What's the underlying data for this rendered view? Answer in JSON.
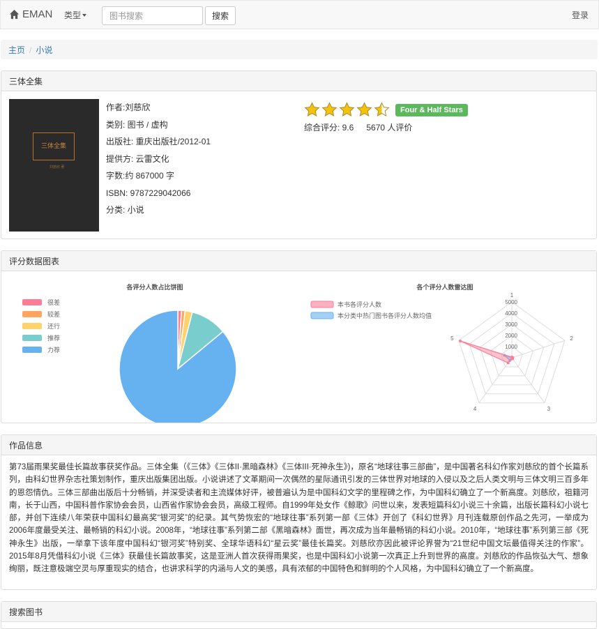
{
  "nav": {
    "brand": "EMAN",
    "type_menu": "类型",
    "search_placeholder": "图书搜索",
    "search_button": "搜索",
    "login": "登录"
  },
  "breadcrumb": [
    "主页",
    "小说"
  ],
  "book": {
    "title": "三体全集",
    "cover_text": "三体全集",
    "cover_author": "刘慈欣 著",
    "info": [
      "作者:刘慈欣",
      "类别: 图书 / 虚构",
      "出版社: 重庆出版社/2012-01",
      "提供方: 云雷文化",
      "字数:约 867000 字",
      "ISBN: 9787229042066",
      "分类:  小说"
    ],
    "rating": {
      "stars": 4.5,
      "badge": "Four & Half Stars",
      "score_text": "综合评分: 9.6",
      "count_text": "5670 人评价",
      "star_color": "#f4c20d"
    }
  },
  "chart_panel_title": "评分数据图表",
  "chart_data": [
    {
      "type": "pie",
      "title": "各评分人数占比饼图",
      "legend_position": "left",
      "categories": [
        "很差",
        "较差",
        "还行",
        "推荐",
        "力荐"
      ],
      "colors": [
        "#ff7c96",
        "#ffa55e",
        "#ffd26b",
        "#7acdcd",
        "#66b1ef"
      ],
      "values": [
        1,
        1,
        2,
        10,
        86
      ]
    },
    {
      "type": "radar",
      "title": "各个评分人数雷达图",
      "legend_position": "top-left",
      "categories": [
        "1",
        "2",
        "3",
        "4",
        "5"
      ],
      "rmax": 5000,
      "tick_labels": [
        "1000",
        "2000",
        "3000",
        "4000",
        "5000"
      ],
      "series": [
        {
          "name": "本书各评分人数",
          "color": "#ff7c96",
          "values": [
            60,
            80,
            120,
            570,
            4860
          ]
        },
        {
          "name": "本分类中热门图书各评分人数均值",
          "color": "#66b1ef",
          "values": [
            40,
            50,
            80,
            300,
            700
          ]
        }
      ]
    }
  ],
  "desc_panel_title": "作品信息",
  "description": "第73届雨果奖最佳长篇故事获奖作品。三体全集（《三体》《三体II·黑暗森林》《三体III·死神永生》)，原名“地球往事三部曲”，是中国著名科幻作家刘慈欣的首个长篇系列，由科幻世界杂志社策划制作，重庆出版集团出版。小说讲述了文革期间一次偶然的星际通讯引发的三体世界对地球的入侵以及之后人类文明与三体文明三百多年的恩怨情仇。三体三部曲出版后十分畅销，并深受读者和主流媒体好评，被普遍认为是中国科幻文学的里程碑之作，为中国科幻确立了一个新高度。刘慈欣，祖籍河南，长于山西，中国科普作家协会会员，山西省作家协会会员，高级工程师。自1999年处女作《鲸歌》问世以来，发表短篇科幻小说三十余篇，出版长篇科幻小说七部，并创下连续八年荣获中国科幻最高奖“银河奖”的纪录。其气势恢宏的“地球往事”系列第一部《三体》开创了《科幻世界》月刊连载原创作品之先河，一举成为2006年度最受关注、最畅销的科幻小说。2008年，“地球往事”系列第二部《黑暗森林》面世，再次成为当年最畅销的科幻小说。2010年，“地球往事”系列第三部《死神永生》出版，一举拿下该年度中国科幻“银河奖”特别奖、全球华语科幻“星云奖”最佳长篇奖。刘慈欣亦因此被评论界誉为“21世纪中国文坛最值得关注的作家”。2015年8月凭借科幻小说《三体》获最佳长篇故事奖，这是亚洲人首次获得雨果奖，也是中国科幻小说第一次真正上升到世界的高度。刘慈欣的作品恢弘大气、想象绚丽，既注意极端空灵与厚重现实的结合，也讲求科学的内涵与人文的美感，具有浓郁的中国特色和鲜明的个人风格，为中国科幻确立了一个新高度。",
  "search_panel_title": "搜索图书"
}
